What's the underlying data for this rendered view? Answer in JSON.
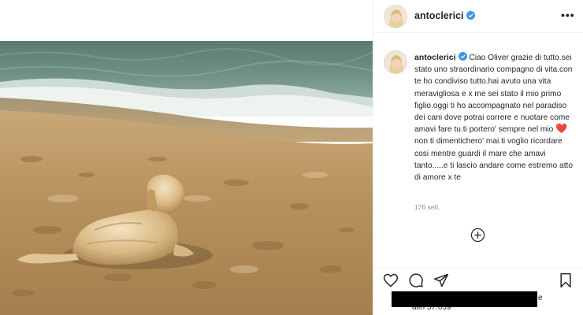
{
  "post": {
    "username": "antoclerici",
    "verified": true,
    "caption_user": "antoclerici",
    "caption_text_1": "Ciao Oliver grazie di tutto.sei stato uno straordinario compagno di vita.con te ho condiviso tutto.hai avuto una vita meravigliosa e x me sei stato il mio primo figlio.oggi ti ho accompagnato nel paradiso dei cani dove potrai correre e nuotare come amavi fare tu.ti portero' sempre nel mio ",
    "caption_emoji": "❤️",
    "caption_text_2": " non ti dimentichero' mai.ti voglio ricordare cosi mentre guardi il mare che amavi tanto.....e ti lascio andare come estremo atto di amore x te",
    "time_ago": "176 sett.",
    "likes_prefix": "altri 57.659",
    "likes_tail": "e"
  },
  "icons": {
    "more": "more-options-icon",
    "verified": "verified-badge-icon",
    "load_more": "plus-circle-icon",
    "like": "heart-icon",
    "comment": "comment-icon",
    "share": "paper-plane-icon",
    "save": "bookmark-icon"
  },
  "colors": {
    "heart": "#ed4956",
    "verified": "#3897f0",
    "text": "#262626",
    "muted": "#8e8e8e"
  }
}
